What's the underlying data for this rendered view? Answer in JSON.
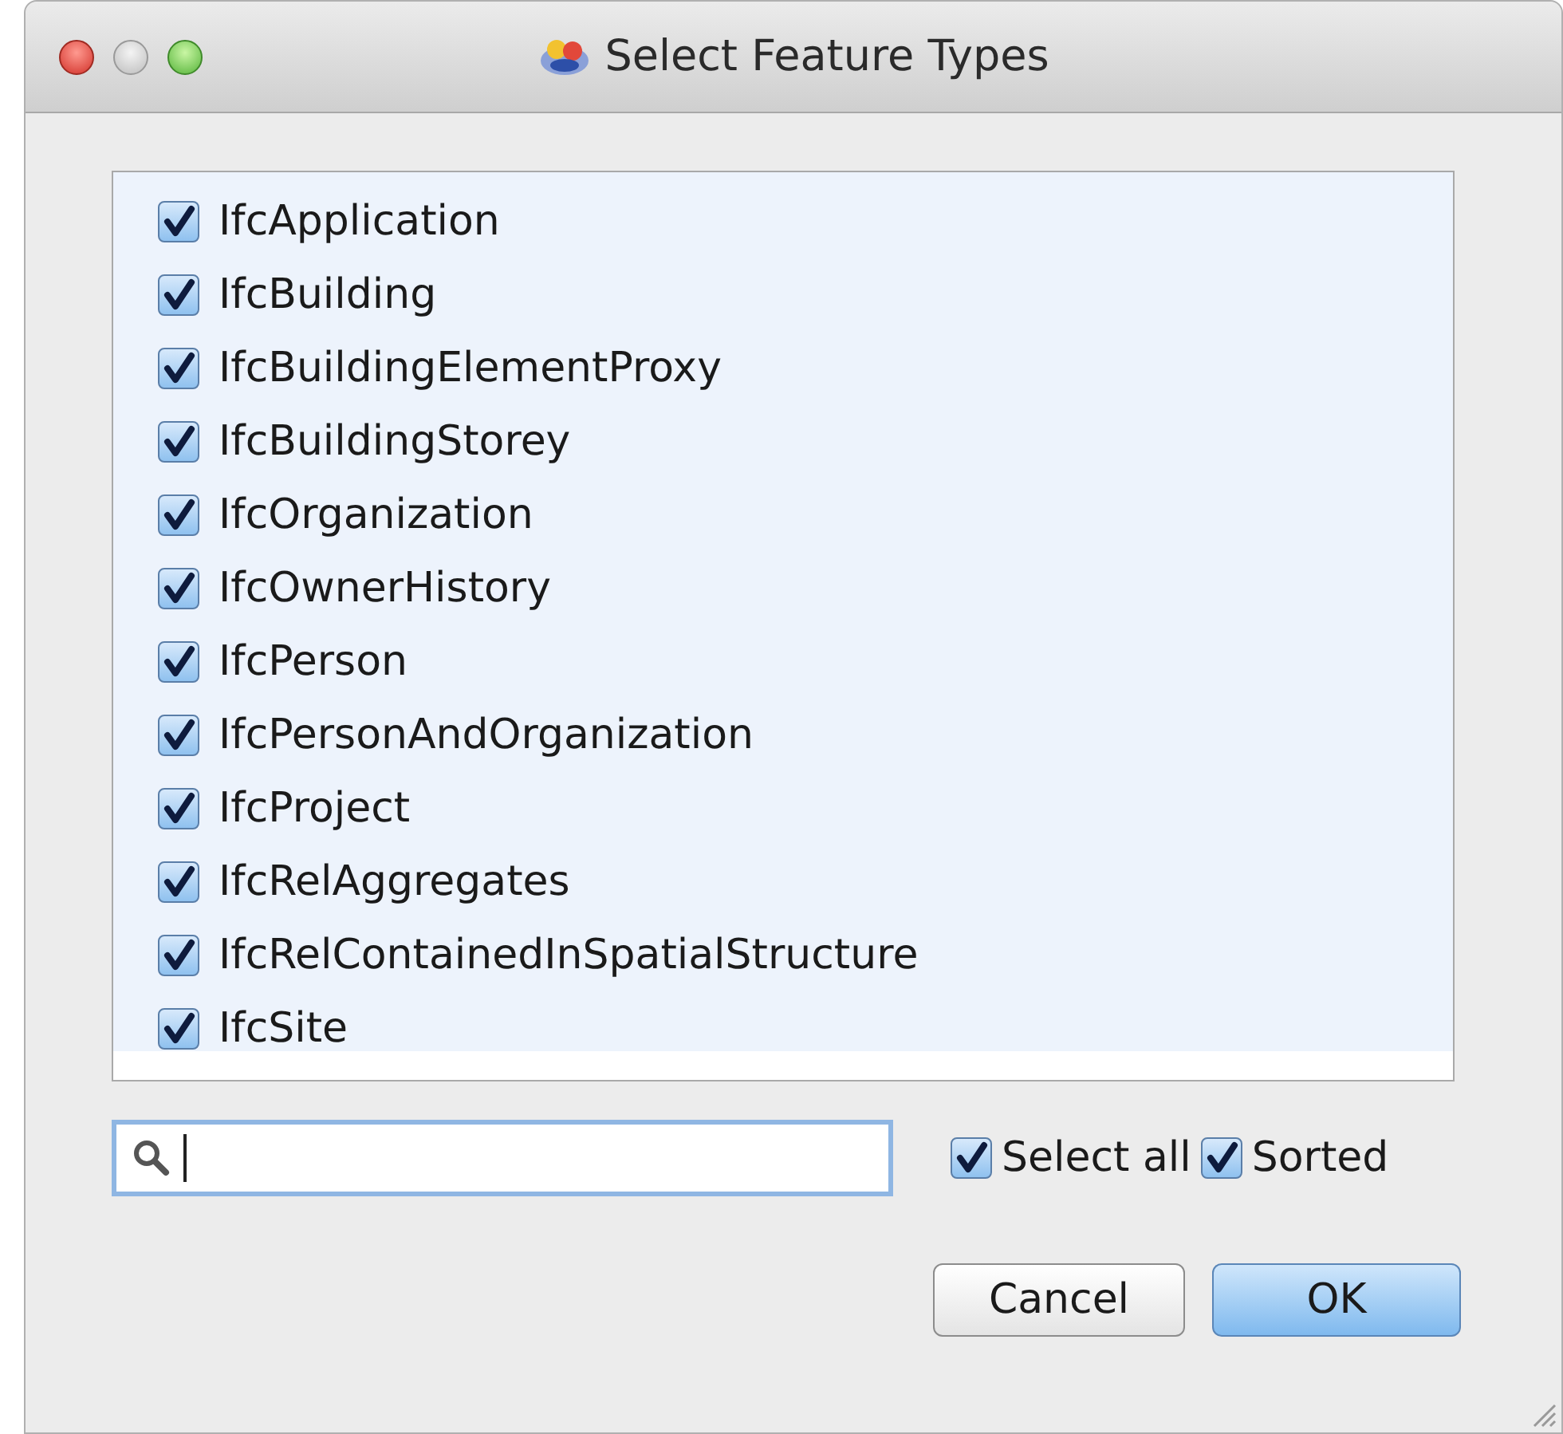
{
  "window": {
    "title": "Select Feature Types"
  },
  "feature_types": [
    {
      "label": "IfcApplication",
      "checked": true
    },
    {
      "label": "IfcBuilding",
      "checked": true
    },
    {
      "label": "IfcBuildingElementProxy",
      "checked": true
    },
    {
      "label": "IfcBuildingStorey",
      "checked": true
    },
    {
      "label": "IfcOrganization",
      "checked": true
    },
    {
      "label": "IfcOwnerHistory",
      "checked": true
    },
    {
      "label": "IfcPerson",
      "checked": true
    },
    {
      "label": "IfcPersonAndOrganization",
      "checked": true
    },
    {
      "label": "IfcProject",
      "checked": true
    },
    {
      "label": "IfcRelAggregates",
      "checked": true
    },
    {
      "label": "IfcRelContainedInSpatialStructure",
      "checked": true
    },
    {
      "label": "IfcSite",
      "checked": true
    }
  ],
  "options": [
    {
      "label": "Select all",
      "checked": true
    },
    {
      "label": "Sorted",
      "checked": true
    }
  ],
  "buttons": [
    {
      "label": "Cancel",
      "kind": "secondary"
    },
    {
      "label": "OK",
      "kind": "default"
    }
  ]
}
